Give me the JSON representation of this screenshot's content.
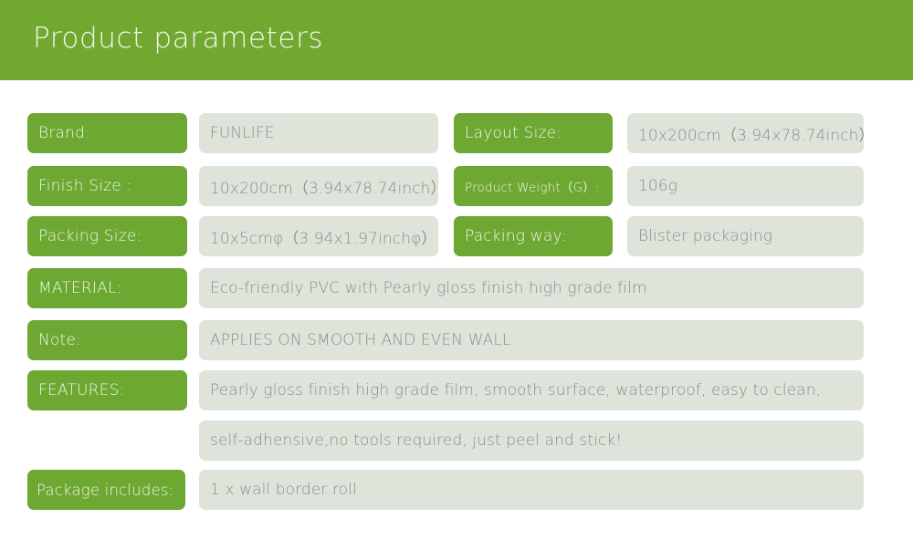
{
  "header": {
    "title": "Product parameters",
    "background_color": "#70a830"
  },
  "theme": {
    "label_color": "#6da833",
    "label_text_color": "#f0f6e8",
    "value_color": "#dfe4da",
    "value_text_color": "#8c8c8c",
    "page_background": "#ffffff"
  },
  "rows": [
    {
      "left": {
        "label": "Brand:",
        "value": "FUNLIFE"
      },
      "right": {
        "label": "Layout Size:",
        "value": "10x200cm（3.94x78.74inch）"
      }
    },
    {
      "left": {
        "label": "Finish Size :",
        "value": "10x200cm（3.94x78.74inch）"
      },
      "right": {
        "label": "Product Weight（G）:",
        "value": "106g"
      }
    },
    {
      "left": {
        "label": "Packing Size:",
        "value": "10x5cmφ（3.94x1.97inchφ）"
      },
      "right": {
        "label": "Packing way:",
        "value": "Blister packaging"
      }
    }
  ],
  "full_rows": [
    {
      "label": "MATERIAL:",
      "value": "Eco-friendly PVC with Pearly gloss finish high grade film"
    },
    {
      "label": "Note:",
      "value": "APPLIES ON SMOOTH AND EVEN WALL"
    },
    {
      "label": "FEATURES:",
      "value": "Pearly gloss finish high grade film, smooth surface, waterproof, easy to clean,"
    },
    {
      "label": "",
      "value": "self-adhensive,no tools required, just peel and stick!"
    },
    {
      "label": "Package includes:",
      "value": "1 x wall border roll"
    }
  ]
}
